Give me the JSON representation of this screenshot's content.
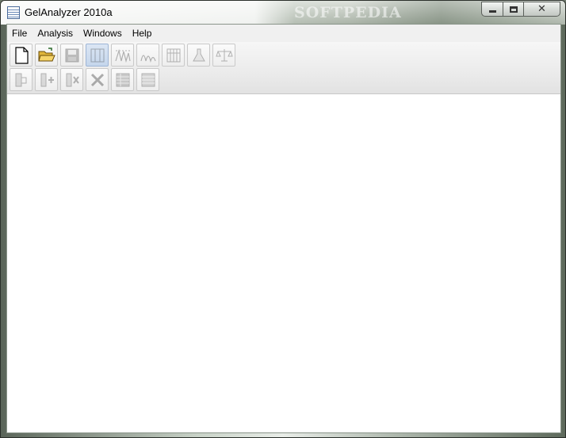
{
  "window": {
    "title": "GelAnalyzer 2010a",
    "watermark": "SOFTPEDIA",
    "caption_buttons": {
      "minimize": "minimize-icon",
      "maximize": "maximize-icon",
      "close": "close-icon",
      "close_glyph": "✕"
    }
  },
  "menu": {
    "items": [
      {
        "label": "File"
      },
      {
        "label": "Analysis"
      },
      {
        "label": "Windows"
      },
      {
        "label": "Help"
      }
    ]
  },
  "toolbar": {
    "row1": [
      {
        "icon": "new-document-icon",
        "enabled": true
      },
      {
        "icon": "open-folder-icon",
        "enabled": true
      },
      {
        "icon": "save-icon",
        "enabled": false
      },
      {
        "icon": "lanes-icon",
        "enabled": false
      },
      {
        "icon": "peaks-icon",
        "enabled": false
      },
      {
        "icon": "profile-icon",
        "enabled": false
      },
      {
        "icon": "grid-icon",
        "enabled": false
      },
      {
        "icon": "flask-icon",
        "enabled": false
      },
      {
        "icon": "scales-icon",
        "enabled": false
      }
    ],
    "row2": [
      {
        "icon": "hand-icon",
        "enabled": false
      },
      {
        "icon": "add-lane-icon",
        "enabled": false
      },
      {
        "icon": "remove-lane-icon",
        "enabled": false
      },
      {
        "icon": "delete-icon",
        "enabled": false
      },
      {
        "icon": "table-icon",
        "enabled": false
      },
      {
        "icon": "table-list-icon",
        "enabled": false
      }
    ]
  },
  "colors": {
    "client_background": "#ffffff",
    "menubar_background": "#f0f0f0",
    "toolbar_background": "#ebebeb"
  }
}
